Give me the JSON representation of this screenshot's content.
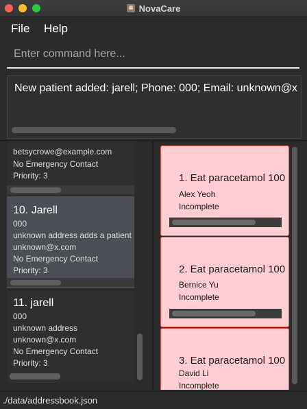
{
  "window": {
    "title": "NovaCare"
  },
  "menu": {
    "file": "File",
    "help": "Help"
  },
  "command": {
    "placeholder": "Enter command here...",
    "value": ""
  },
  "result": {
    "text": "New patient added: jarell; Phone: 000; Email: unknown@x"
  },
  "persons": [
    {
      "email": "betsycrowe@example.com",
      "emergency": "No Emergency Contact",
      "priority": "Priority: 3"
    },
    {
      "name": "10. Jarell",
      "phone": "000",
      "address": "unknown address adds a patient",
      "email": "unknown@x.com",
      "emergency": "No Emergency Contact",
      "priority": "Priority: 3"
    },
    {
      "name": "11. jarell",
      "phone": "000",
      "address": "unknown address",
      "email": "unknown@x.com",
      "emergency": "No Emergency Contact",
      "priority": "Priority: 3"
    }
  ],
  "tasks": [
    {
      "title": "1. Eat paracetamol 100",
      "patient": "Alex Yeoh",
      "status": "Incomplete"
    },
    {
      "title": "2. Eat paracetamol 100",
      "patient": "Bernice Yu",
      "status": "Incomplete"
    },
    {
      "title": "3. Eat paracetamol 100",
      "patient": "David Li",
      "status": "Incomplete"
    }
  ],
  "status_bar": {
    "path": "./data/addressbook.json"
  },
  "colors": {
    "task_bg": "#ffcdd2",
    "task_border": "#ef5350",
    "selected_bg": "#4a4f55"
  }
}
